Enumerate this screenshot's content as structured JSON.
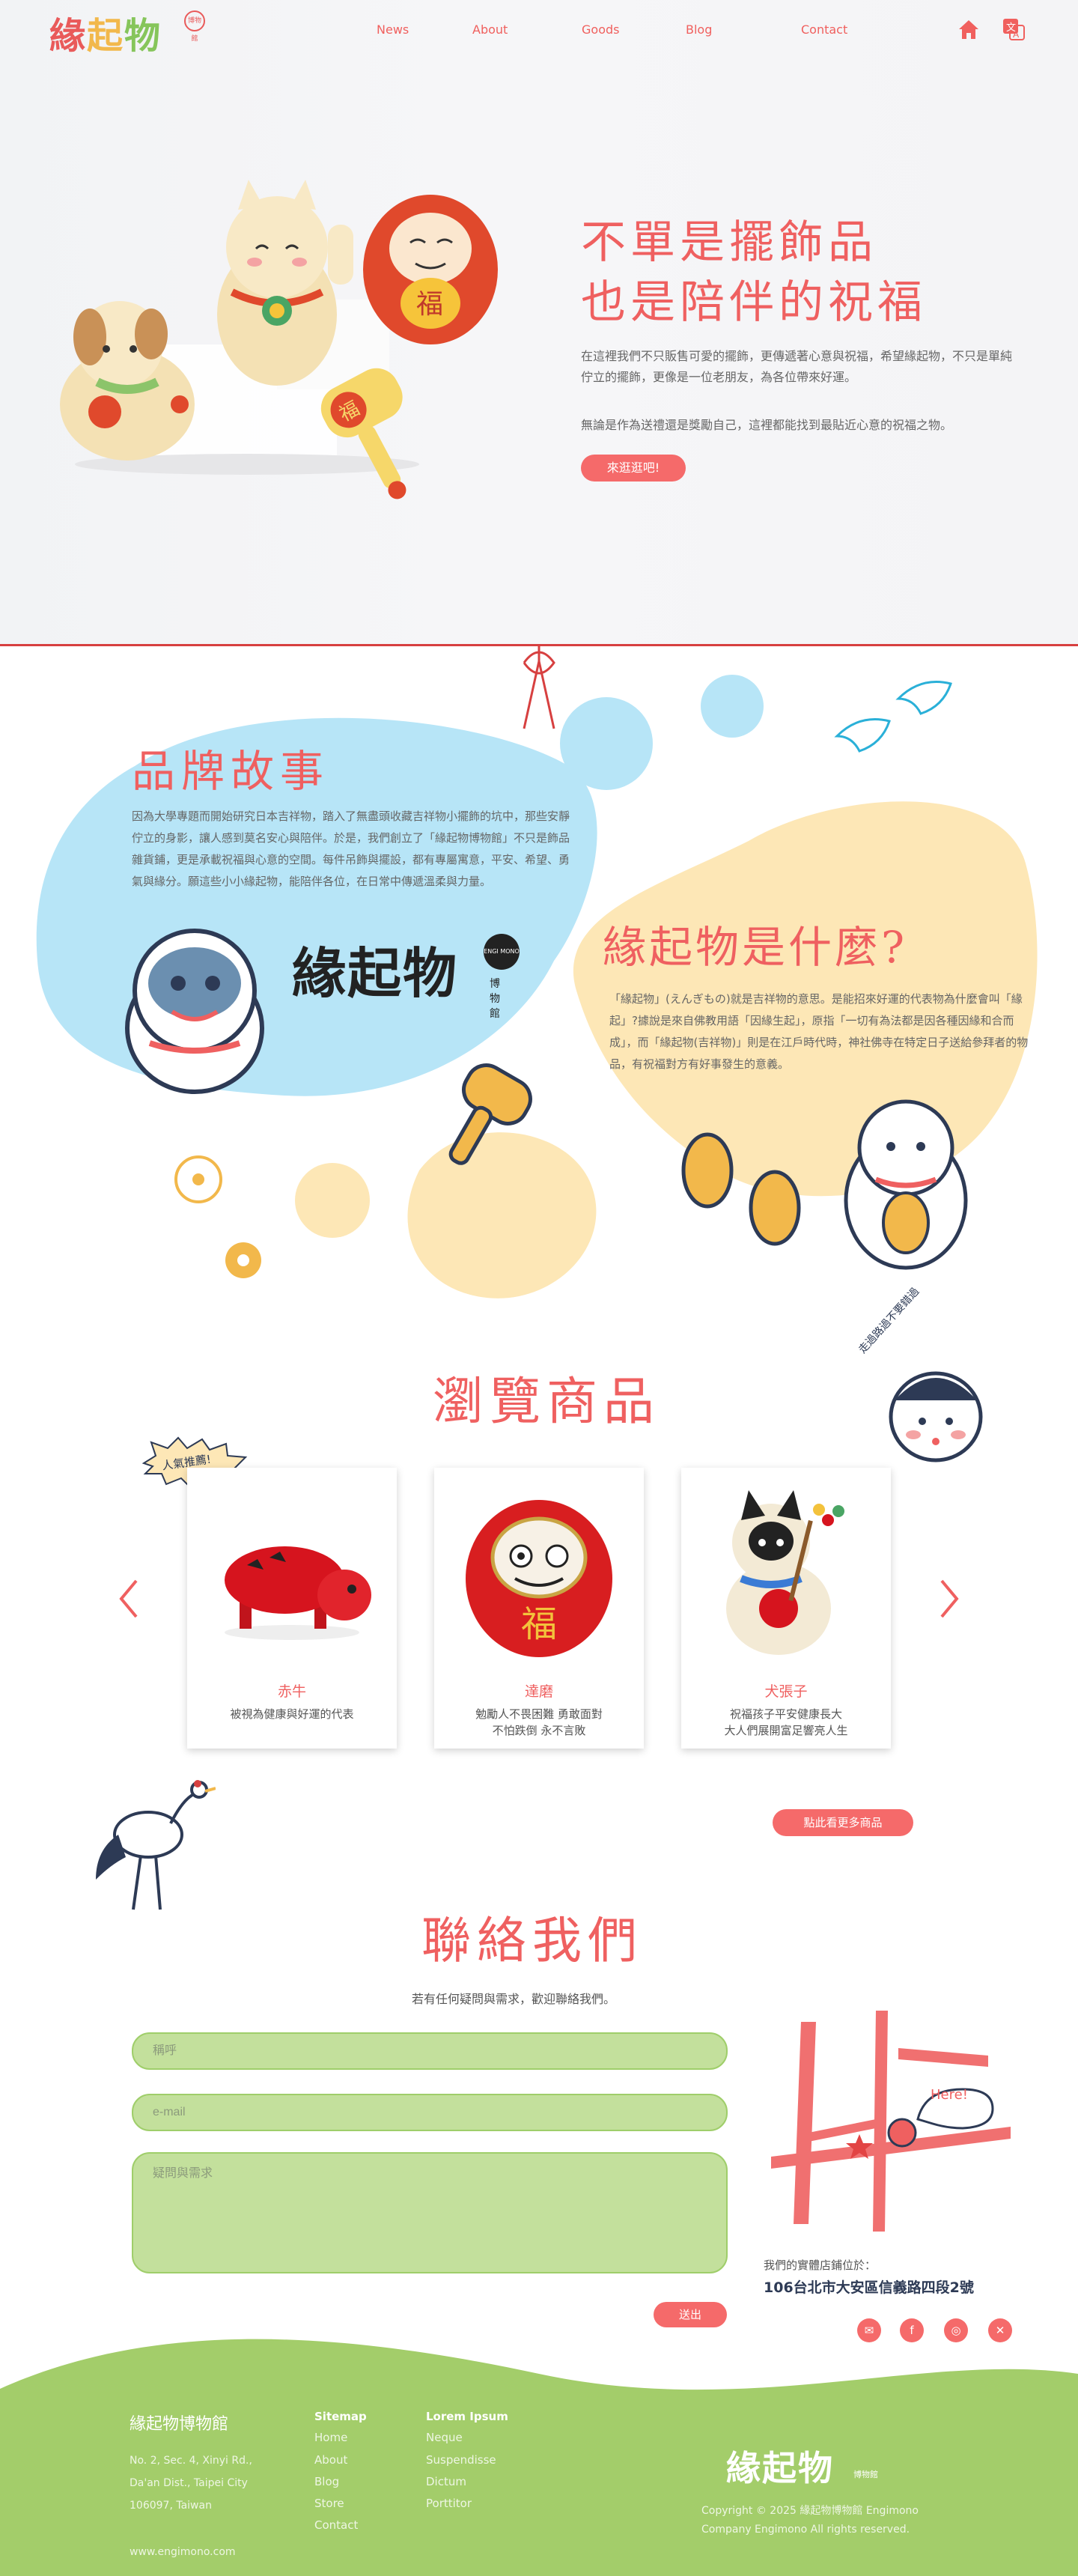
{
  "brand": {
    "logo_chars": [
      "緣",
      "起",
      "物"
    ],
    "logo_badge": "博物館",
    "logo_sub": "博物館"
  },
  "nav": {
    "links": [
      "News",
      "About",
      "Goods",
      "Blog",
      "Contact"
    ],
    "icons": [
      "home-icon",
      "translate-icon"
    ]
  },
  "hero": {
    "title_line1": "不單是擺飾品",
    "title_line2": "也是陪伴的祝福",
    "paragraph1": "在這裡我們不只販售可愛的擺飾，更傳遞著心意與祝福，希望緣起物，不只是單純佇立的擺飾，更像是一位老朋友，為各位帶來好運。",
    "paragraph2": "無論是作為送禮還是獎勵自己，這裡都能找到最貼近心意的祝福之物。",
    "cta": "來逛逛吧!"
  },
  "story": {
    "title": "品牌故事",
    "paragraph": "因為大學專題而開始研究日本吉祥物，踏入了無盡頭收藏吉祥物小擺飾的坑中，那些安靜佇立的身影，讓人感到莫名安心與陪伴。於是，我們創立了「緣起物博物館」不只是飾品雜貨鋪，更是承載祝福與心意的空間。每件吊飾與擺設，都有專屬寓意，平安、希望、勇氣與緣分。願這些小小緣起物，能陪伴各位，在日常中傳遞溫柔與力量。",
    "logo_chars": [
      "緣",
      "起",
      "物"
    ],
    "logo_badge": "ENGI MONO",
    "logo_sub": "博物館"
  },
  "what": {
    "title": "緣起物是什麼?",
    "paragraph": "「緣起物」(えんぎもの)就是吉祥物的意思。是能招來好運的代表物為什麼會叫「緣起」?據說是來自佛教用語「因緣生起」，原指「一切有為法都是因各種因緣和合而成」，而「緣起物(吉祥物)」則是在江戶時代時，神社佛寺在特定日子送給參拜者的物品，有祝福對方有好事發生的意義。"
  },
  "products": {
    "title": "瀏覽商品",
    "badge": "人氣推薦!",
    "side_note": "走過路過不要錯過",
    "items": [
      {
        "name": "赤牛",
        "desc": "被視為健康與好運的代表"
      },
      {
        "name": "達磨",
        "desc": "勉勵人不畏困難 勇敢面對\n不怕跌倒 永不言敗"
      },
      {
        "name": "犬張子",
        "desc": "祝福孩子平安健康長大\n大人們展開富足響亮人生"
      }
    ],
    "more": "點此看更多商品"
  },
  "contact": {
    "title": "聯絡我們",
    "subtitle": "若有任何疑問與需求，歡迎聯絡我們。",
    "name_placeholder": "稱呼",
    "email_placeholder": "e-mail",
    "message_placeholder": "疑問與需求",
    "send": "送出",
    "map_bubble": "Here!",
    "store_label": "我們的實體店鋪位於：",
    "store_address": "106台北市大安區信義路四段2號",
    "socials": [
      "mail-icon",
      "facebook-icon",
      "instagram-icon",
      "x-icon"
    ]
  },
  "footer": {
    "name": "緣起物博物館",
    "address_lines": [
      "No. 2, Sec. 4, Xinyi Rd.,",
      "Da'an Dist., Taipei City",
      "106097, Taiwan"
    ],
    "website": "www.engimono.com",
    "sitemap_title": "Sitemap",
    "sitemap_links": [
      "Home",
      "About",
      "Blog",
      "Store",
      "Contact"
    ],
    "lorem_title": "Lorem Ipsum",
    "lorem_links": [
      "Neque",
      "Suspendisse",
      "Dictum",
      "Porttitor"
    ],
    "logo_chars": [
      "緣",
      "起",
      "物"
    ],
    "logo_sub": "博物館",
    "copyright_line1": "Copyright ©  2025 緣起物博物館 Engimono",
    "copyright_line2": "Company Engimono All rights reserved."
  },
  "colors": {
    "accent": "#f0605e",
    "button": "#f56a6a",
    "green": "#a3cd6a",
    "blue_blob": "#b7e5f7",
    "yellow_blob": "#fde7b6",
    "divider": "#d74040"
  }
}
